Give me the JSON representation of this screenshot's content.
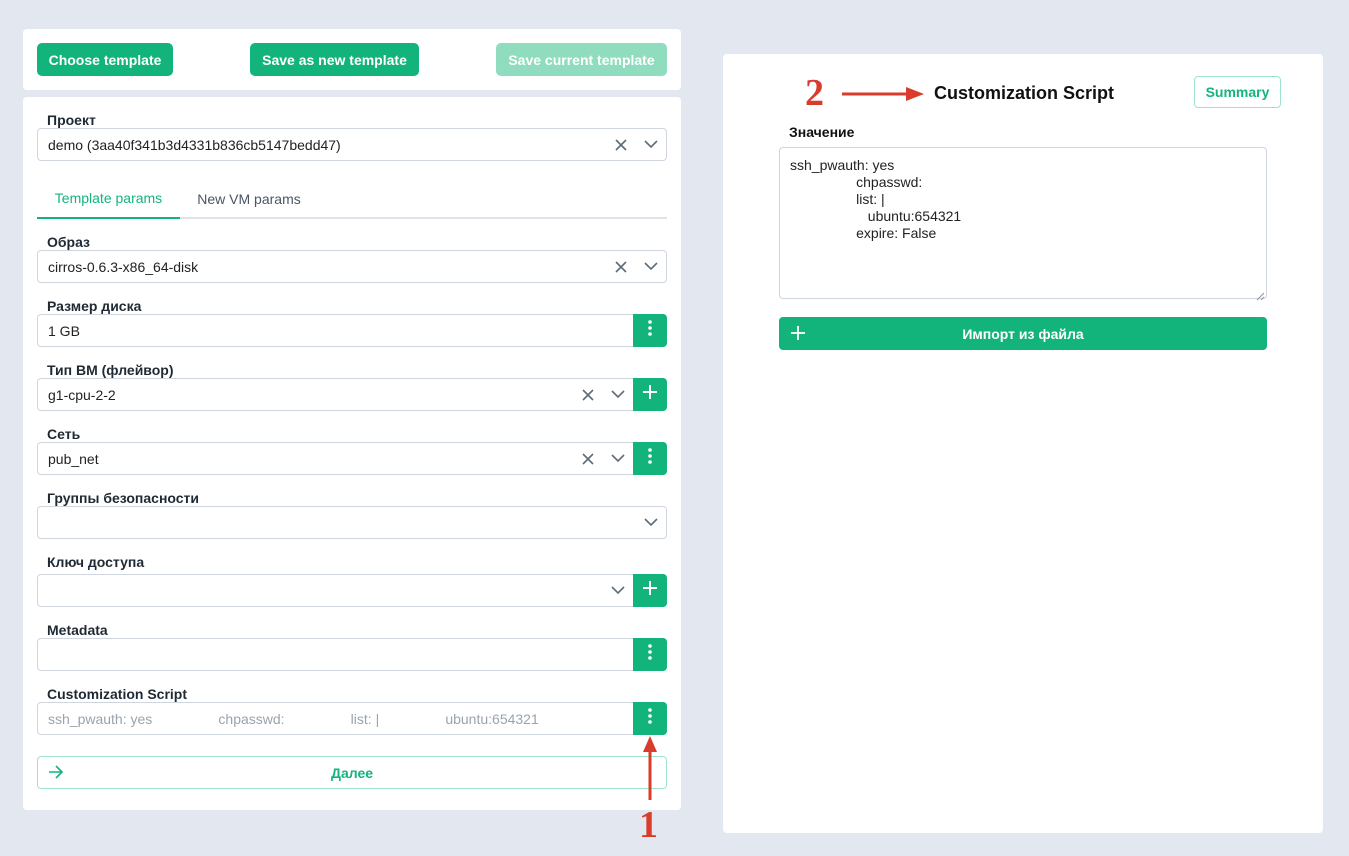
{
  "toolbar": {
    "choose_template": "Choose template",
    "save_new_template": "Save as new template",
    "save_current_template": "Save current template"
  },
  "form": {
    "project": {
      "label": "Проект",
      "value": "demo (3aa40f341b3d4331b836cb5147bedd47)"
    },
    "tabs": [
      {
        "label": "Template params",
        "active": true
      },
      {
        "label": "New VM params",
        "active": false
      }
    ],
    "image": {
      "label": "Образ",
      "value": "cirros-0.6.3-x86_64-disk"
    },
    "disk_size": {
      "label": "Размер диска",
      "value": "1 GB"
    },
    "flavor": {
      "label": "Тип ВМ (флейвор)",
      "value": "g1-cpu-2-2"
    },
    "network": {
      "label": "Сеть",
      "value": "pub_net"
    },
    "security_groups": {
      "label": "Группы безопасности",
      "value": ""
    },
    "access_key": {
      "label": "Ключ доступа",
      "value": ""
    },
    "metadata": {
      "label": "Metadata",
      "value": ""
    },
    "customization_script": {
      "label": "Customization Script",
      "preview": "ssh_pwauth: yes                 chpasswd:                 list: |                 ubuntu:654321"
    },
    "next_label": "Далее"
  },
  "panel": {
    "title": "Customization Script",
    "summary_label": "Summary",
    "value_label": "Значение",
    "script_value": "ssh_pwauth: yes\n                 chpasswd:\n                 list: |\n                    ubuntu:654321\n                 expire: False",
    "import_label": "Импорт из файла"
  },
  "annotations": {
    "marker_1": "1",
    "marker_2": "2"
  },
  "colors": {
    "accent": "#13b47c",
    "accent_light": "#8fdcbf",
    "annotation": "#d93c2c",
    "background": "#e3e8f0"
  }
}
